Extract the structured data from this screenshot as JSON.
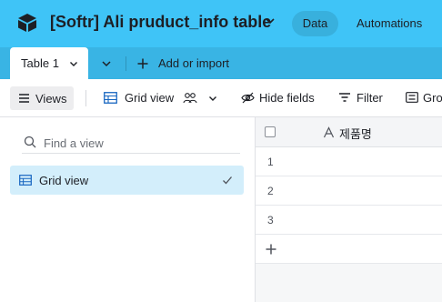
{
  "header": {
    "title": "[Softr] Ali pruduct_info table",
    "nav": {
      "data": "Data",
      "automations": "Automations"
    },
    "accent_color": "#3fc4f7"
  },
  "tabs": {
    "active": "Table 1",
    "add_import": "Add or import"
  },
  "toolbar": {
    "views": "Views",
    "grid_view": "Grid view",
    "hide_fields": "Hide fields",
    "filter": "Filter",
    "group": "Gro"
  },
  "sidebar": {
    "search_placeholder": "Find a view",
    "views": [
      {
        "label": "Grid view",
        "selected": true,
        "icon": "grid-icon"
      }
    ]
  },
  "grid": {
    "column_header": "제품명",
    "rows": [
      "1",
      "2",
      "3"
    ]
  }
}
